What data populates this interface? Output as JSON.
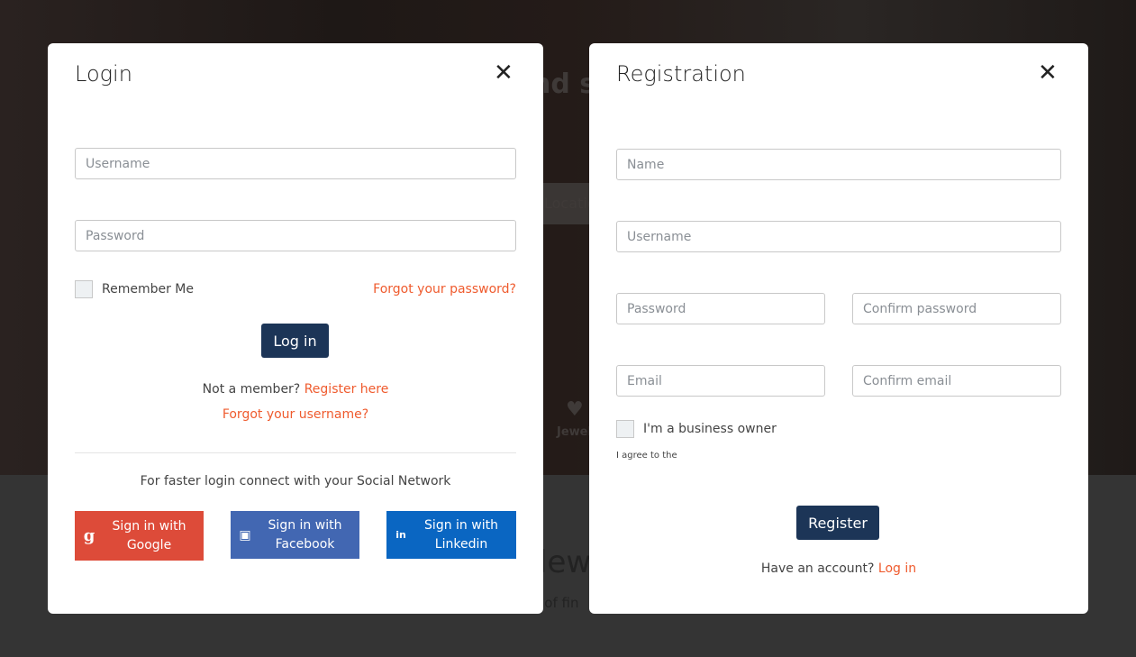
{
  "background": {
    "fragments": [
      "nd s",
      "Locatio",
      "Jewel",
      "lew",
      "n of fin"
    ]
  },
  "login": {
    "title": "Login",
    "username_placeholder": "Username",
    "password_placeholder": "Password",
    "remember_me": "Remember Me",
    "forgot_password": "Forgot your password?",
    "login_button": "Log in",
    "not_member": "Not a member?",
    "register_here": "Register here",
    "forgot_username": "Forgot your username?",
    "social_prompt": "For faster login connect with your Social Network",
    "social": [
      {
        "line1": "Sign in with",
        "line2": "Google",
        "color": "#dd4b39",
        "icon": "google-icon"
      },
      {
        "line1": "Sign in with",
        "line2": "Facebook",
        "color": "#4267b2",
        "icon": "facebook-icon"
      },
      {
        "line1": "Sign in with",
        "line2": "Linkedin",
        "color": "#0a66c2",
        "icon": "linkedin-icon"
      }
    ]
  },
  "registration": {
    "title": "Registration",
    "name_placeholder": "Name",
    "username_placeholder": "Username",
    "password_placeholder": "Password",
    "confirm_password_placeholder": "Confirm password",
    "email_placeholder": "Email",
    "confirm_email_placeholder": "Confirm email",
    "business_owner": "I'm a business owner",
    "agree": "I agree to the",
    "register_button": "Register",
    "have_account": "Have an account?",
    "login_link": "Log in"
  },
  "colors": {
    "accent": "#ef5b2e",
    "primary": "#1c3557"
  }
}
